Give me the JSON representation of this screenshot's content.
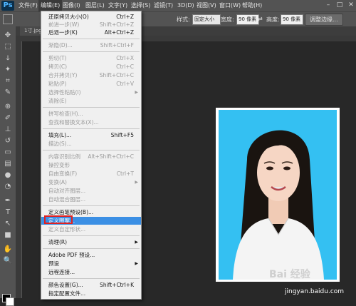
{
  "app": {
    "logo": "Ps"
  },
  "menubar": {
    "items": [
      "文件(F)",
      "编辑(E)",
      "图像(I)",
      "图层(L)",
      "文字(Y)",
      "选择(S)",
      "滤镜(T)",
      "3D(D)",
      "视图(V)",
      "窗口(W)",
      "帮助(H)"
    ]
  },
  "options_bar": {
    "style_label": "样式:",
    "style_value": "固定大小",
    "width_label": "宽度:",
    "width_value": "90 像素",
    "height_label": "高度:",
    "height_value": "90 像素",
    "adjust_button": "调整边缘..."
  },
  "document": {
    "tab": "1寸.jpg"
  },
  "edit_menu": {
    "items": [
      {
        "label": "还原拷贝大小(O)",
        "shortcut": "Ctrl+Z",
        "disabled": false
      },
      {
        "label": "前进一步(W)",
        "shortcut": "Shift+Ctrl+Z",
        "disabled": true
      },
      {
        "label": "后退一步(K)",
        "shortcut": "Alt+Ctrl+Z",
        "disabled": false
      },
      {
        "label": "渐隐(D)...",
        "shortcut": "Shift+Ctrl+F",
        "disabled": true
      },
      {
        "label": "剪切(T)",
        "shortcut": "Ctrl+X",
        "disabled": true
      },
      {
        "label": "拷贝(C)",
        "shortcut": "Ctrl+C",
        "disabled": true
      },
      {
        "label": "合并拷贝(Y)",
        "shortcut": "Shift+Ctrl+C",
        "disabled": true
      },
      {
        "label": "粘贴(P)",
        "shortcut": "Ctrl+V",
        "disabled": true
      },
      {
        "label": "选择性粘贴(I)",
        "shortcut": "",
        "disabled": true,
        "submenu": true
      },
      {
        "label": "清除(E)",
        "shortcut": "",
        "disabled": true
      },
      {
        "label": "拼写检查(H)...",
        "shortcut": "",
        "disabled": true
      },
      {
        "label": "查找和替换文本(X)...",
        "shortcut": "",
        "disabled": true
      },
      {
        "label": "填充(L)...",
        "shortcut": "Shift+F5",
        "disabled": false
      },
      {
        "label": "描边(S)...",
        "shortcut": "",
        "disabled": true
      },
      {
        "label": "内容识别比例",
        "shortcut": "Alt+Shift+Ctrl+C",
        "disabled": true
      },
      {
        "label": "操控变形",
        "shortcut": "",
        "disabled": true
      },
      {
        "label": "自由变换(F)",
        "shortcut": "Ctrl+T",
        "disabled": true
      },
      {
        "label": "变换(A)",
        "shortcut": "",
        "disabled": true,
        "submenu": true
      },
      {
        "label": "自动对齐图层...",
        "shortcut": "",
        "disabled": true
      },
      {
        "label": "自动混合图层...",
        "shortcut": "",
        "disabled": true
      },
      {
        "label": "定义画笔预设(B)...",
        "shortcut": "",
        "disabled": false
      },
      {
        "label": "定义图案...",
        "shortcut": "",
        "disabled": false,
        "highlighted": true
      },
      {
        "label": "定义自定形状...",
        "shortcut": "",
        "disabled": true
      },
      {
        "label": "清理(R)",
        "shortcut": "",
        "disabled": false,
        "submenu": true
      },
      {
        "label": "Adobe PDF 预设...",
        "shortcut": "",
        "disabled": false
      },
      {
        "label": "预设",
        "shortcut": "",
        "disabled": false,
        "submenu": true
      },
      {
        "label": "远程连接...",
        "shortcut": "",
        "disabled": false
      },
      {
        "label": "颜色设置(G)...",
        "shortcut": "Shift+Ctrl+K",
        "disabled": false
      },
      {
        "label": "指定配置文件...",
        "shortcut": "",
        "disabled": false
      }
    ]
  },
  "watermark": {
    "text": "Bai 经验",
    "site": "jingyan.baidu.com"
  },
  "colors": {
    "photo_bg": "#34c0f2",
    "highlight": "#3b8fe4",
    "annotation": "#e02020"
  }
}
